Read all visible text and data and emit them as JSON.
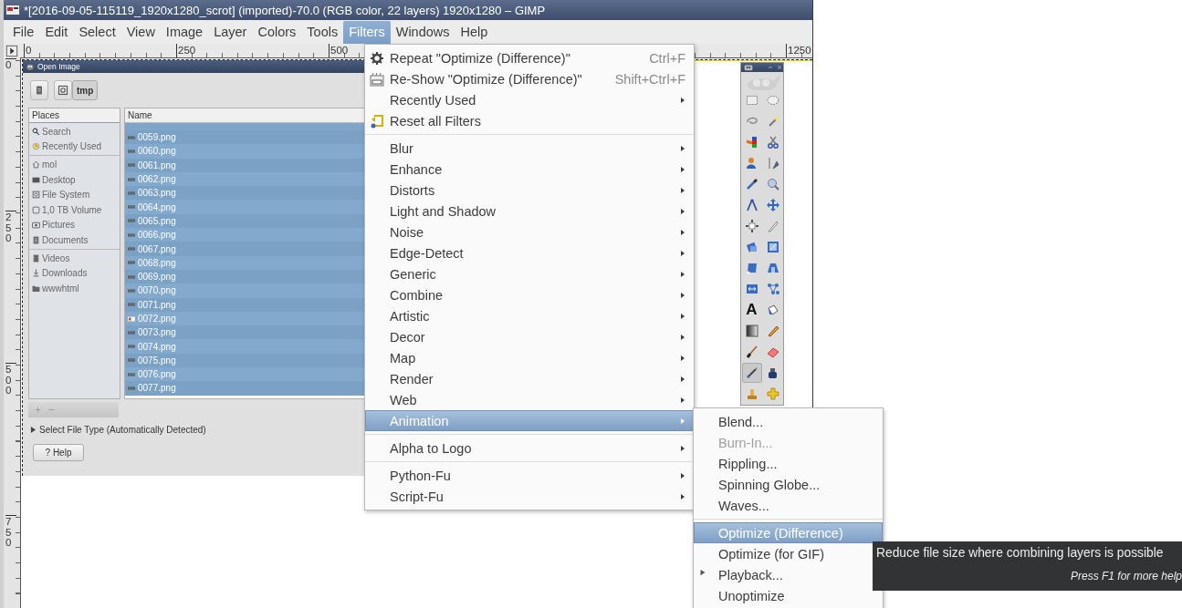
{
  "window": {
    "title": "*[2016-09-05-115119_1920x1280_scrot] (imported)-70.0 (RGB color, 22 layers) 1920x1280 – GIMP"
  },
  "menubar": [
    {
      "label": "File",
      "selected": false
    },
    {
      "label": "Edit",
      "selected": false
    },
    {
      "label": "Select",
      "selected": false
    },
    {
      "label": "View",
      "selected": false
    },
    {
      "label": "Image",
      "selected": false
    },
    {
      "label": "Layer",
      "selected": false
    },
    {
      "label": "Colors",
      "selected": false
    },
    {
      "label": "Tools",
      "selected": false
    },
    {
      "label": "Filters",
      "selected": true
    },
    {
      "label": "Windows",
      "selected": false
    },
    {
      "label": "Help",
      "selected": false
    }
  ],
  "top_ruler": {
    "labels": [
      "0",
      "250",
      "500",
      "1250"
    ]
  },
  "left_ruler": {
    "labels": [
      "0",
      "250",
      "500",
      "750"
    ]
  },
  "open_image_dialog": {
    "title": "Open Image",
    "path_button": "tmp",
    "places": {
      "header": "Places",
      "groups": [
        {
          "items": [
            {
              "label": "Search"
            },
            {
              "label": "Recently Used"
            }
          ]
        },
        {
          "items": [
            {
              "label": "mol"
            },
            {
              "label": "Desktop"
            },
            {
              "label": "File System"
            },
            {
              "label": "1,0 TB Volume"
            },
            {
              "label": "Pictures"
            },
            {
              "label": "Documents"
            }
          ]
        },
        {
          "items": [
            {
              "label": "Videos"
            },
            {
              "label": "Downloads"
            },
            {
              "label": "wwwhtml"
            }
          ]
        }
      ]
    },
    "files": {
      "header": "Name",
      "rows": [
        {
          "name": "0059.png",
          "selected": true
        },
        {
          "name": "0060.png",
          "selected": true
        },
        {
          "name": "0061.png",
          "selected": true
        },
        {
          "name": "0062.png",
          "selected": true
        },
        {
          "name": "0063.png",
          "selected": true
        },
        {
          "name": "0064.png",
          "selected": true
        },
        {
          "name": "0065.png",
          "selected": true
        },
        {
          "name": "0066.png",
          "selected": true
        },
        {
          "name": "0067.png",
          "selected": true
        },
        {
          "name": "0068.png",
          "selected": true
        },
        {
          "name": "0069.png",
          "selected": true
        },
        {
          "name": "0070.png",
          "selected": true
        },
        {
          "name": "0071.png",
          "selected": true
        },
        {
          "name": "0072.png",
          "selected": true
        },
        {
          "name": "0073.png",
          "selected": true
        },
        {
          "name": "0074.png",
          "selected": true
        },
        {
          "name": "0075.png",
          "selected": true
        },
        {
          "name": "0076.png",
          "selected": true
        },
        {
          "name": "0077.png",
          "selected": true
        }
      ]
    },
    "file_type_expander": {
      "label": "Select File Type (Automatically Detected)",
      "expanded": false
    },
    "help_button": "? Help"
  },
  "toolbox": {
    "tools": [
      {
        "selected": false
      },
      {
        "selected": false
      },
      {
        "selected": false
      },
      {
        "selected": false
      },
      {
        "selected": false
      },
      {
        "selected": false
      },
      {
        "selected": false
      },
      {
        "selected": false
      },
      {
        "selected": false
      },
      {
        "selected": false
      },
      {
        "selected": false
      },
      {
        "selected": false
      },
      {
        "selected": false
      },
      {
        "selected": false
      },
      {
        "selected": false
      },
      {
        "selected": false
      },
      {
        "selected": false
      },
      {
        "selected": false
      },
      {
        "selected": false
      },
      {
        "selected": false
      },
      {
        "glyph": "A",
        "selected": false
      },
      {
        "selected": false
      },
      {
        "selected": false
      },
      {
        "selected": false
      },
      {
        "selected": false
      },
      {
        "selected": false
      },
      {
        "selected": true
      },
      {
        "selected": false
      },
      {
        "selected": false
      },
      {
        "selected": false
      }
    ]
  },
  "filters_menu": {
    "items": [
      {
        "kind": "command",
        "label": "Repeat \"Optimize (Difference)\"",
        "shortcut": "Ctrl+F",
        "selected": false
      },
      {
        "kind": "command",
        "label": "Re-Show \"Optimize (Difference)\"",
        "shortcut": "Shift+Ctrl+F",
        "selected": false
      },
      {
        "kind": "submenu",
        "label": "Recently Used",
        "selected": false
      },
      {
        "kind": "command",
        "label": "Reset all Filters",
        "selected": false
      },
      {
        "kind": "separator"
      },
      {
        "kind": "submenu",
        "label": "Blur",
        "selected": false
      },
      {
        "kind": "submenu",
        "label": "Enhance",
        "selected": false
      },
      {
        "kind": "submenu",
        "label": "Distorts",
        "selected": false
      },
      {
        "kind": "submenu",
        "label": "Light and Shadow",
        "selected": false
      },
      {
        "kind": "submenu",
        "label": "Noise",
        "selected": false
      },
      {
        "kind": "submenu",
        "label": "Edge-Detect",
        "selected": false
      },
      {
        "kind": "submenu",
        "label": "Generic",
        "selected": false
      },
      {
        "kind": "submenu",
        "label": "Combine",
        "selected": false
      },
      {
        "kind": "submenu",
        "label": "Artistic",
        "selected": false
      },
      {
        "kind": "submenu",
        "label": "Decor",
        "selected": false
      },
      {
        "kind": "submenu",
        "label": "Map",
        "selected": false
      },
      {
        "kind": "submenu",
        "label": "Render",
        "selected": false
      },
      {
        "kind": "submenu",
        "label": "Web",
        "selected": false
      },
      {
        "kind": "submenu",
        "label": "Animation",
        "selected": true
      },
      {
        "kind": "separator"
      },
      {
        "kind": "submenu",
        "label": "Alpha to Logo",
        "selected": false
      },
      {
        "kind": "separator"
      },
      {
        "kind": "submenu",
        "label": "Python-Fu",
        "selected": false
      },
      {
        "kind": "submenu",
        "label": "Script-Fu",
        "selected": false
      }
    ]
  },
  "animation_submenu": {
    "items": [
      {
        "kind": "command",
        "label": "Blend...",
        "disabled": false,
        "selected": false
      },
      {
        "kind": "command",
        "label": "Burn-In...",
        "disabled": true,
        "selected": false
      },
      {
        "kind": "command",
        "label": "Rippling...",
        "disabled": false,
        "selected": false
      },
      {
        "kind": "command",
        "label": "Spinning Globe...",
        "disabled": false,
        "selected": false
      },
      {
        "kind": "command",
        "label": "Waves...",
        "disabled": false,
        "selected": false
      },
      {
        "kind": "separator"
      },
      {
        "kind": "command",
        "label": "Optimize (Difference)",
        "disabled": false,
        "selected": true
      },
      {
        "kind": "command",
        "label": "Optimize (for GIF)",
        "disabled": false,
        "selected": false
      },
      {
        "kind": "command",
        "label": "Playback...",
        "disabled": false,
        "selected": false
      },
      {
        "kind": "command",
        "label": "Unoptimize",
        "disabled": false,
        "selected": false
      }
    ]
  },
  "tooltip": {
    "text": "Reduce file size where combining layers is possible",
    "hint": "Press F1 for more help"
  }
}
